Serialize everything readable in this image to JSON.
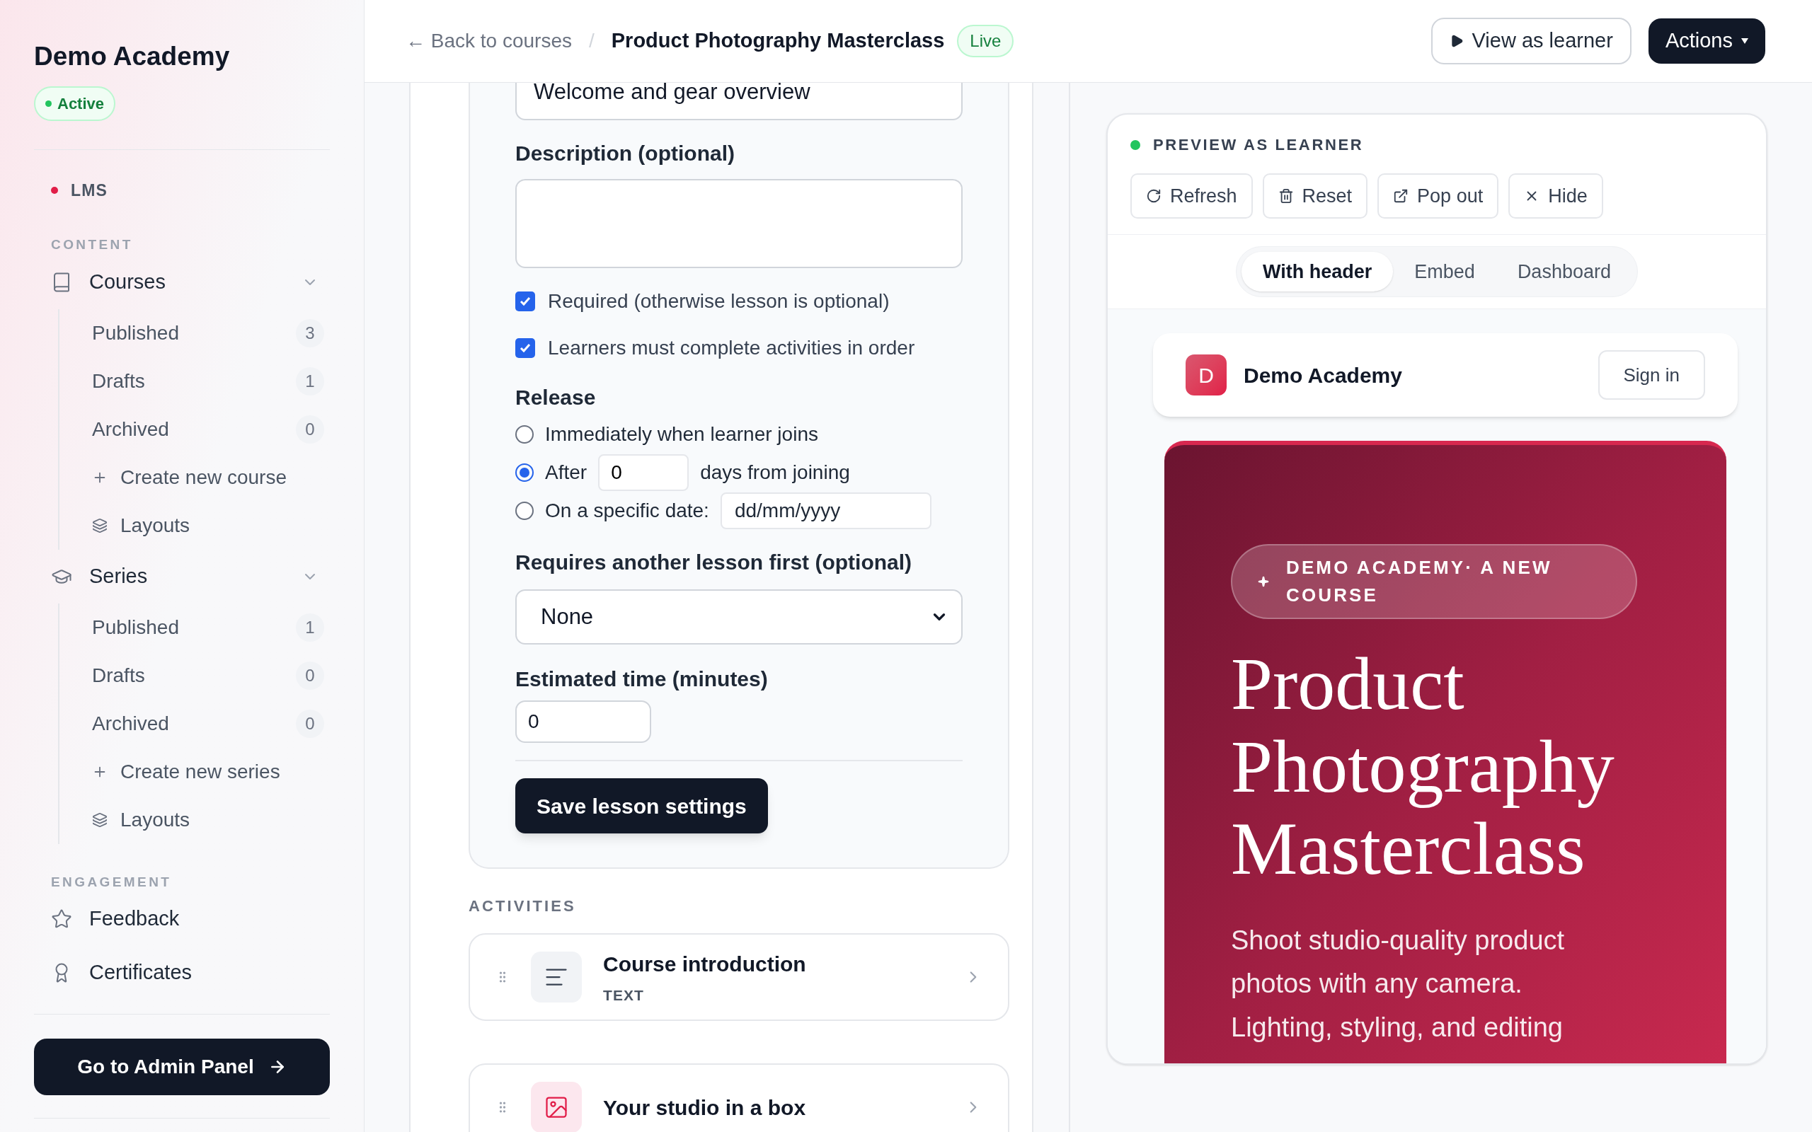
{
  "sidebar": {
    "brand": "Demo Academy",
    "status": "Active",
    "app": "LMS",
    "sections": [
      {
        "heading": "CONTENT",
        "items": [
          {
            "kind": "courses",
            "label": "Courses",
            "expanded": true,
            "children": [
              {
                "kind": "link",
                "label": "Published",
                "count": "3"
              },
              {
                "kind": "link",
                "label": "Drafts",
                "count": "1"
              },
              {
                "kind": "link",
                "label": "Archived",
                "count": "0"
              },
              {
                "kind": "create",
                "label": "Create new course"
              },
              {
                "kind": "layouts",
                "label": "Layouts"
              }
            ]
          },
          {
            "kind": "series",
            "label": "Series",
            "expanded": true,
            "children": [
              {
                "kind": "link",
                "label": "Published",
                "count": "1"
              },
              {
                "kind": "link",
                "label": "Drafts",
                "count": "0"
              },
              {
                "kind": "link",
                "label": "Archived",
                "count": "0"
              },
              {
                "kind": "create",
                "label": "Create new series"
              },
              {
                "kind": "layouts",
                "label": "Layouts"
              }
            ]
          }
        ]
      },
      {
        "heading": "ENGAGEMENT",
        "items": [
          {
            "kind": "feedback",
            "label": "Feedback"
          },
          {
            "kind": "certificates",
            "label": "Certificates"
          }
        ]
      }
    ],
    "admin_button": "Go to Admin Panel"
  },
  "header": {
    "back_link": "← Back to courses",
    "separator": "/",
    "title": "Product Photography Masterclass",
    "status": "Live",
    "buttons": [
      {
        "kind": "outline",
        "label": "View as learner"
      },
      {
        "kind": "primary",
        "label": "Actions"
      }
    ]
  },
  "form": {
    "title_value": "Welcome and gear overview",
    "description_label": "Description (optional)",
    "checkboxes": [
      {
        "label": "Required (otherwise lesson is optional)",
        "checked": true
      },
      {
        "label": "Learners must complete activities in order",
        "checked": true
      }
    ],
    "release": {
      "label": "Release",
      "options": [
        {
          "kind": "plain",
          "label": "Immediately when learner joins",
          "selected": false
        },
        {
          "kind": "days",
          "label": "After",
          "value": "0",
          "suffix": "days from joining",
          "selected": true
        },
        {
          "kind": "date",
          "label": "On a specific date:",
          "placeholder": "dd/mm/yyyy",
          "selected": false
        }
      ]
    },
    "prerequisite": {
      "label": "Requires another lesson first (optional)",
      "value": "None"
    },
    "estimate": {
      "label": "Estimated time (minutes)",
      "value": "0"
    },
    "save_button": "Save lesson settings"
  },
  "activities": {
    "heading": "ACTIVITIES",
    "items": [
      {
        "kind": "text",
        "title": "Course introduction",
        "type": "TEXT"
      },
      {
        "kind": "media",
        "title": "Your studio in a box"
      }
    ]
  },
  "preview": {
    "heading": "PREVIEW AS LEARNER",
    "buttons": [
      {
        "kind": "refresh",
        "label": "Refresh"
      },
      {
        "kind": "reset",
        "label": "Reset"
      },
      {
        "kind": "popout",
        "label": "Pop out"
      },
      {
        "kind": "hide",
        "label": "Hide"
      }
    ],
    "tabs": [
      {
        "label": "With header",
        "selected": true
      },
      {
        "label": "Embed",
        "selected": false
      },
      {
        "label": "Dashboard",
        "selected": false
      }
    ],
    "site": {
      "logo": "D",
      "name": "Demo Academy",
      "sign_in": "Sign in"
    },
    "hero": {
      "eyebrow": "DEMO ACADEMY· A NEW COURSE",
      "title": "Product Photography Masterclass",
      "description": "Shoot studio-quality product photos with any camera. Lighting, styling, and editing"
    }
  }
}
